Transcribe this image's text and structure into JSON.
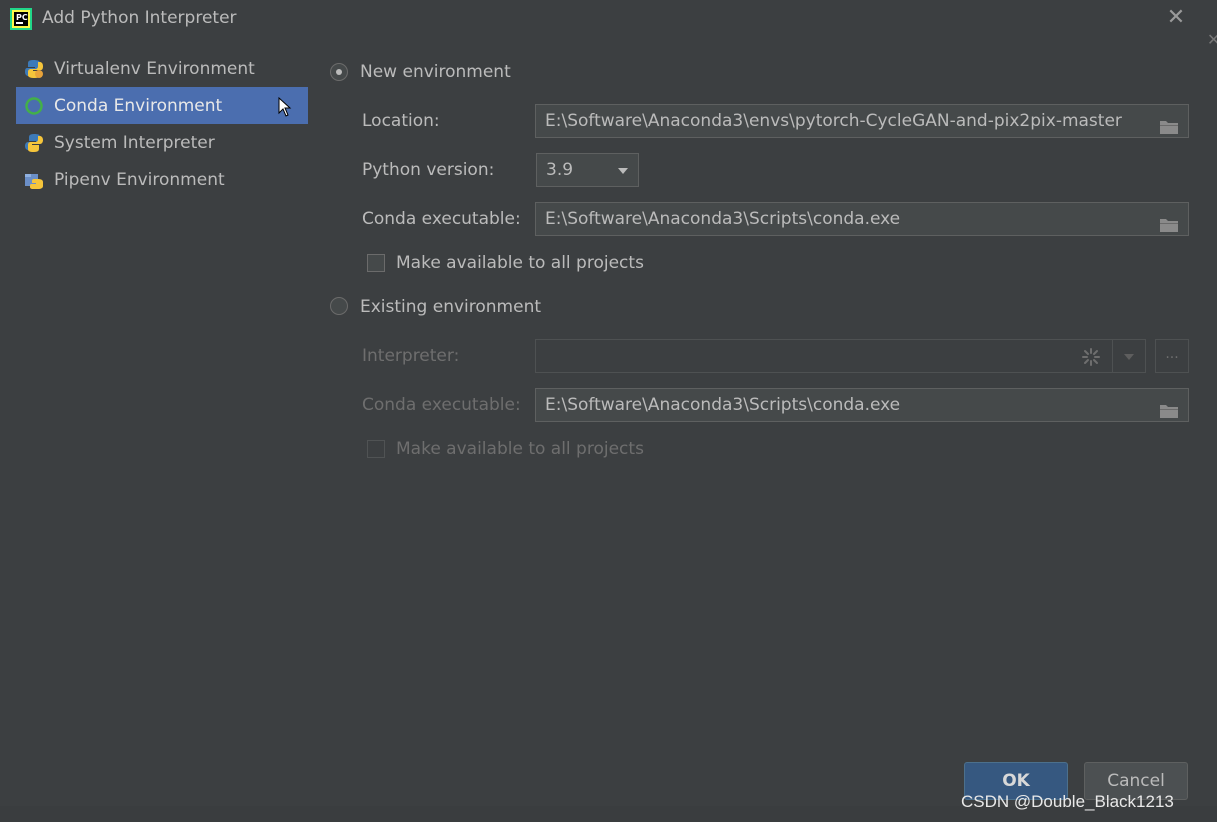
{
  "window": {
    "title": "Add Python Interpreter",
    "close_glyph": "✕",
    "edge_glyph": "✕"
  },
  "sidebar": {
    "items": [
      {
        "label": "Virtualenv Environment",
        "icon": "virtualenv-icon",
        "selected": false
      },
      {
        "label": "Conda Environment",
        "icon": "conda-icon",
        "selected": true
      },
      {
        "label": "System Interpreter",
        "icon": "python-icon",
        "selected": false
      },
      {
        "label": "Pipenv Environment",
        "icon": "pipenv-icon",
        "selected": false
      }
    ]
  },
  "new_env": {
    "radio_label": "New environment",
    "selected": true,
    "location_label": "Location:",
    "location_value": "E:\\Software\\Anaconda3\\envs\\pytorch-CycleGAN-and-pix2pix-master",
    "python_version_label": "Python version:",
    "python_version_value": "3.9",
    "conda_exe_label": "Conda executable:",
    "conda_exe_value": "E:\\Software\\Anaconda3\\Scripts\\conda.exe",
    "make_available_label": "Make available to all projects"
  },
  "existing_env": {
    "radio_label": "Existing environment",
    "selected": false,
    "interpreter_label": "Interpreter:",
    "browse_label": "...",
    "conda_exe_label": "Conda executable:",
    "conda_exe_value": "E:\\Software\\Anaconda3\\Scripts\\conda.exe",
    "make_available_label": "Make available to all projects"
  },
  "buttons": {
    "ok": "OK",
    "cancel": "Cancel"
  },
  "watermark": "CSDN @Double_Black1213",
  "colors": {
    "background": "#3c3f41",
    "selection": "#4b6eaf",
    "ok_button": "#365880",
    "text": "#bbbbbb"
  }
}
